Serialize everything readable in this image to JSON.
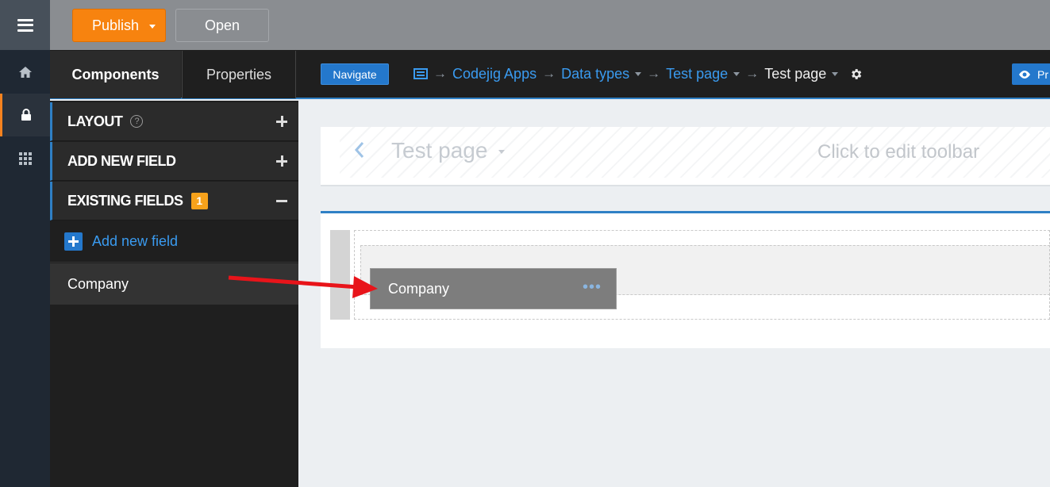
{
  "topbar": {
    "publish_label": "Publish",
    "open_label": "Open"
  },
  "rail": {
    "items": [
      {
        "icon": "home-icon"
      },
      {
        "icon": "lock-icon",
        "active": true
      },
      {
        "icon": "grid-icon"
      }
    ]
  },
  "tabs": {
    "components": "Components",
    "properties": "Properties"
  },
  "navigate_label": "Navigate",
  "breadcrumb": {
    "items": [
      "Codejig Apps",
      "Data types",
      "Test page",
      "Test page"
    ]
  },
  "preview_label": "Pr",
  "panel": {
    "layout": "LAYOUT",
    "add_new_field_section": "ADD NEW FIELD",
    "existing_fields": "EXISTING FIELDS",
    "existing_count": "1",
    "add_new_field_link": "Add new field",
    "fields": [
      "Company"
    ]
  },
  "canvas": {
    "toolbar_title": "Test page",
    "toolbar_hint": "Click to edit toolbar",
    "field_label": "Company",
    "field_menu": "•••"
  },
  "colors": {
    "accent_orange": "#f7830f",
    "link_blue": "#3a9bf0",
    "annotation_red": "#e8141a"
  }
}
